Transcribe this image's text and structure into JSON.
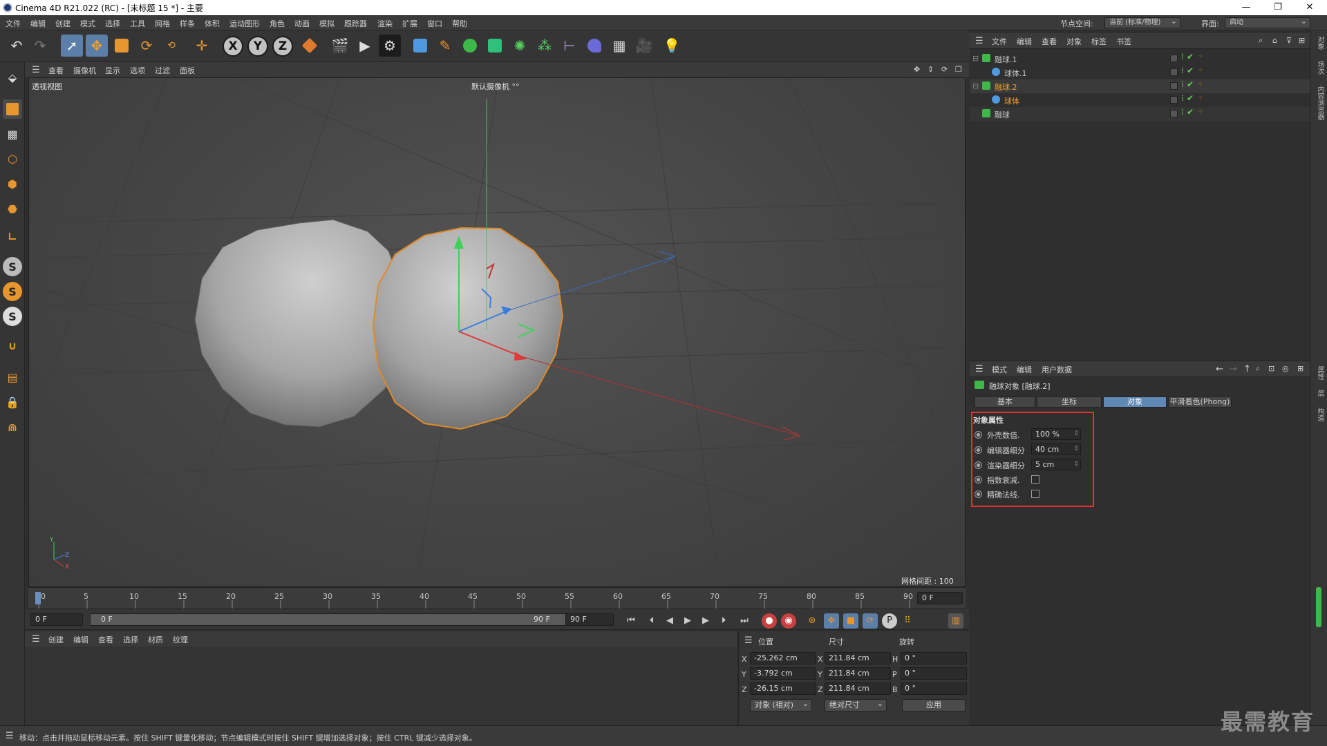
{
  "window": {
    "title": "Cinema 4D R21.022 (RC) - [未标题 15 *] - 主要",
    "min": "—",
    "restore": "❐",
    "close": "✕"
  },
  "menubar": {
    "items": [
      "文件",
      "编辑",
      "创建",
      "模式",
      "选择",
      "工具",
      "网格",
      "样条",
      "体积",
      "运动图形",
      "角色",
      "动画",
      "模拟",
      "跟踪器",
      "渲染",
      "扩展",
      "窗口",
      "帮助"
    ],
    "node_space_label": "节点空间:",
    "node_space_value": "当前 (标准/物理)",
    "layout_label": "界面:",
    "layout_value": "启动"
  },
  "viewport": {
    "menu": [
      "查看",
      "摄像机",
      "显示",
      "选项",
      "过滤",
      "面板"
    ],
    "view_name": "透视视图",
    "camera_name": "默认摄像机 °°",
    "grid_info": "网格间距 : 100 cm",
    "axis_y": "Y",
    "axis_z": "Z",
    "axis_x": "X"
  },
  "timeline": {
    "ticks": [
      "0",
      "5",
      "10",
      "15",
      "20",
      "25",
      "30",
      "35",
      "40",
      "45",
      "50",
      "55",
      "60",
      "65",
      "70",
      "75",
      "80",
      "85",
      "90"
    ],
    "current_frame": "0 F",
    "start_frame": "0 F",
    "range_start": "0 F",
    "range_end": "90 F",
    "end_frame": "90 F"
  },
  "material_manager": {
    "menu": [
      "创建",
      "编辑",
      "查看",
      "选择",
      "材质",
      "纹理"
    ]
  },
  "coordinates": {
    "headers": {
      "position": "位置",
      "size": "尺寸",
      "rotation": "旋转"
    },
    "rows": [
      {
        "axis": "X",
        "pos": "-25.262 cm",
        "size_axis": "X",
        "size": "211.84 cm",
        "rot_axis": "H",
        "rot": "0 °"
      },
      {
        "axis": "Y",
        "pos": "-3.792 cm",
        "size_axis": "Y",
        "size": "211.84 cm",
        "rot_axis": "P",
        "rot": "0 °"
      },
      {
        "axis": "Z",
        "pos": "-26.15 cm",
        "size_axis": "Z",
        "size": "211.84 cm",
        "rot_axis": "B",
        "rot": "0 °"
      }
    ],
    "mode": "对象 (相对)",
    "size_mode": "绝对尺寸",
    "apply": "应用"
  },
  "status": {
    "text": "移动：点击并拖动鼠标移动元素。按住 SHIFT 键量化移动；节点编辑模式时按住 SHIFT 键增加选择对象；按住 CTRL 键减少选择对象。"
  },
  "object_manager": {
    "menu": [
      "文件",
      "编辑",
      "查看",
      "对象",
      "标签",
      "书签"
    ],
    "objects": [
      {
        "name": "融球.1",
        "indent": 0,
        "selected": false
      },
      {
        "name": "球体.1",
        "indent": 1,
        "selected": false
      },
      {
        "name": "融球.2",
        "indent": 0,
        "selected": true
      },
      {
        "name": "球体",
        "indent": 1,
        "selected": true
      },
      {
        "name": "融球",
        "indent": 0,
        "selected": false
      }
    ]
  },
  "attribute_manager": {
    "menu": [
      "模式",
      "编辑",
      "用户数据"
    ],
    "object_title": "融球对象 [融球.2]",
    "tabs": [
      "基本",
      "坐标",
      "对象",
      "平滑着色(Phong)"
    ],
    "active_tab": "对象",
    "section_title": "对象属性",
    "props": [
      {
        "label": "外壳数值.",
        "value": "100 %"
      },
      {
        "label": "编辑器细分",
        "value": "40 cm"
      },
      {
        "label": "渲染器细分",
        "value": "5 cm"
      }
    ],
    "checks": [
      {
        "label": "指数衰减."
      },
      {
        "label": "精确法线."
      }
    ]
  },
  "right_strip": [
    "对象",
    "场次",
    "内容浏览器",
    "属性",
    "层",
    "构造"
  ],
  "watermark": "最需教育",
  "colors": {
    "accent": "#5f88b4",
    "highlight": "#e0322e",
    "selection": "#e8a040",
    "grid_bg": "#474747"
  }
}
